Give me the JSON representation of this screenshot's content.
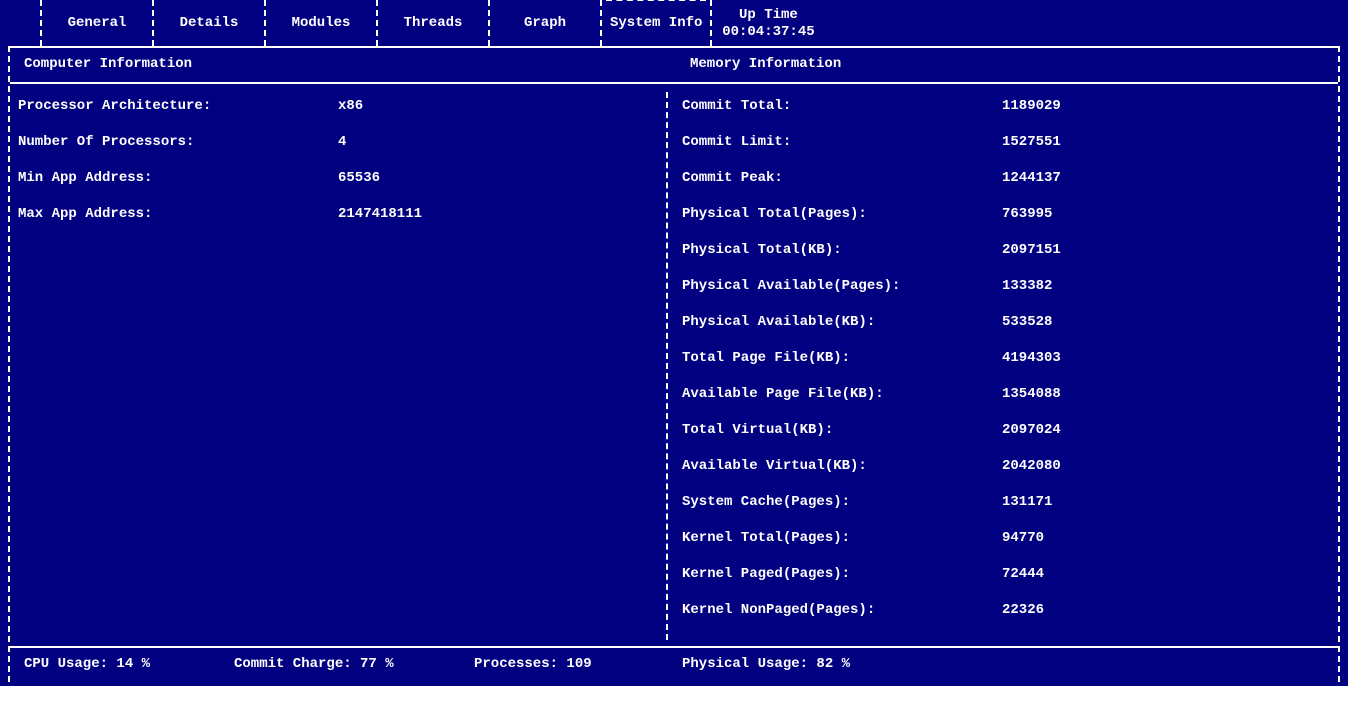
{
  "tabs": [
    {
      "label": "General"
    },
    {
      "label": "Details"
    },
    {
      "label": "Modules"
    },
    {
      "label": "Threads"
    },
    {
      "label": "Graph"
    },
    {
      "label": "System Info",
      "active": true
    },
    {
      "label": "Up Time",
      "sub": "00:04:37:45"
    }
  ],
  "sections": {
    "left_title": "Computer Information",
    "right_title": "Memory Information"
  },
  "computer_info": [
    {
      "label": "Processor Architecture:",
      "value": "x86"
    },
    {
      "label": "Number Of Processors:",
      "value": "4"
    },
    {
      "label": "Min App Address:",
      "value": "65536"
    },
    {
      "label": "Max App Address:",
      "value": "2147418111"
    }
  ],
  "memory_info": [
    {
      "label": "Commit Total:",
      "value": "1189029"
    },
    {
      "label": "Commit Limit:",
      "value": "1527551"
    },
    {
      "label": "Commit Peak:",
      "value": "1244137"
    },
    {
      "label": "Physical Total(Pages):",
      "value": "763995"
    },
    {
      "label": "Physical Total(KB):",
      "value": "2097151"
    },
    {
      "label": "Physical Available(Pages):",
      "value": "133382"
    },
    {
      "label": "Physical Available(KB):",
      "value": "533528"
    },
    {
      "label": "Total Page File(KB):",
      "value": "4194303"
    },
    {
      "label": "Available Page File(KB):",
      "value": "1354088"
    },
    {
      "label": "Total Virtual(KB):",
      "value": "2097024"
    },
    {
      "label": "Available Virtual(KB):",
      "value": "2042080"
    },
    {
      "label": "System Cache(Pages):",
      "value": "131171"
    },
    {
      "label": "Kernel Total(Pages):",
      "value": "94770"
    },
    {
      "label": "Kernel Paged(Pages):",
      "value": "72444"
    },
    {
      "label": "Kernel NonPaged(Pages):",
      "value": "22326"
    }
  ],
  "status": {
    "cpu": "CPU Usage: 14 %",
    "commit": "Commit Charge: 77 %",
    "procs": "Processes: 109",
    "physical": "Physical Usage: 82 %"
  }
}
